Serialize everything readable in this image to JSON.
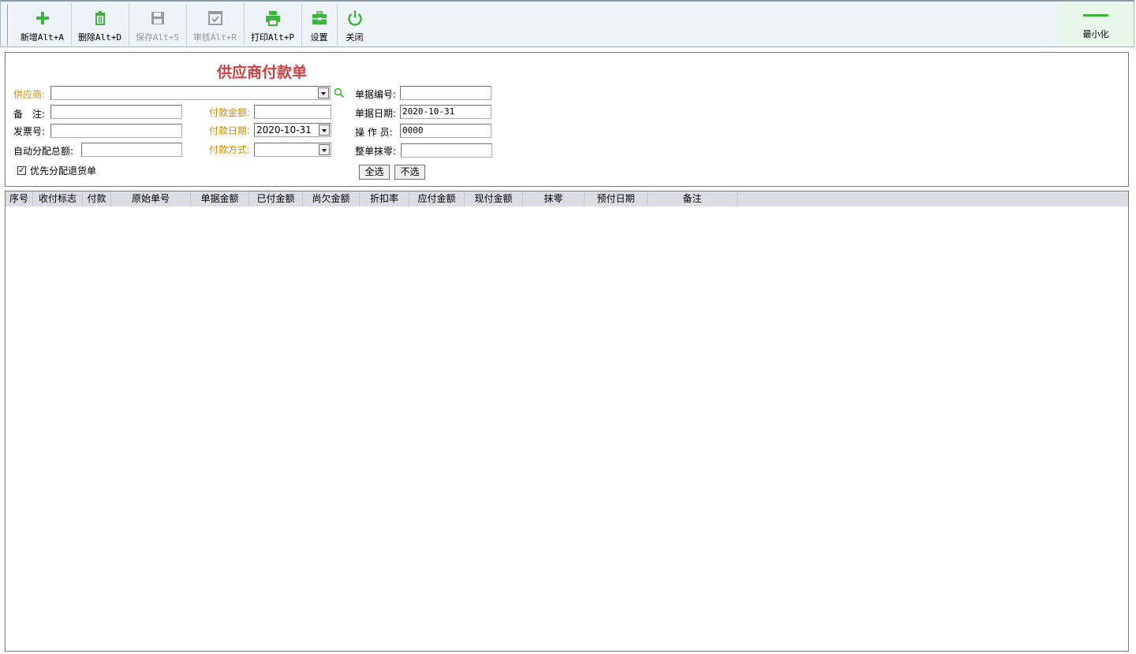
{
  "toolbar": {
    "buttons": [
      {
        "label": "新增Alt+A",
        "icon": "plus-icon",
        "enabled": true
      },
      {
        "label": "删除Alt+D",
        "icon": "trash-icon",
        "enabled": true
      },
      {
        "label": "保存Alt+S",
        "icon": "save-icon",
        "enabled": false
      },
      {
        "label": "审核Alt+R",
        "icon": "approve-icon",
        "enabled": false
      },
      {
        "label": "打印Alt+P",
        "icon": "printer-icon",
        "enabled": true
      },
      {
        "label": "设置",
        "icon": "toolbox-icon",
        "enabled": true
      },
      {
        "label": "关闭",
        "icon": "power-icon",
        "enabled": true
      }
    ],
    "minimize_label": "最小化"
  },
  "form": {
    "title": "供应商付款单",
    "supplier_label": "供应商:",
    "supplier_value": "",
    "remark_label": "备　注:",
    "remark_value": "",
    "invoice_label": "发票号:",
    "invoice_value": "",
    "auto_total_label": "自动分配总额:",
    "auto_total_value": "",
    "prefer_return_label": "优先分配退货单",
    "prefer_return_checked": true,
    "pay_amount_label": "付款金额:",
    "pay_amount_value": "",
    "pay_date_label": "付款日期:",
    "pay_date_value": "2020-10-31",
    "pay_method_label": "付款方式:",
    "pay_method_value": "",
    "doc_no_label": "单据编号:",
    "doc_no_value": "",
    "doc_date_label": "单据日期:",
    "doc_date_value": "2020-10-31",
    "operator_label": "操 作 员:",
    "operator_value": "0000",
    "round_off_label": "整单抹零:",
    "round_off_value": "",
    "select_all_label": "全选",
    "select_none_label": "不选"
  },
  "grid": {
    "columns": [
      "序号",
      "收付标志",
      "付款",
      "原始单号",
      "单据金额",
      "已付金额",
      "尚欠金额",
      "折扣率",
      "应付金额",
      "现付金额",
      "抹零",
      "预付日期",
      "备注"
    ]
  },
  "colors": {
    "accent_green": "#3db53d",
    "title_red": "#d04040",
    "label_orange": "#d28a00"
  }
}
